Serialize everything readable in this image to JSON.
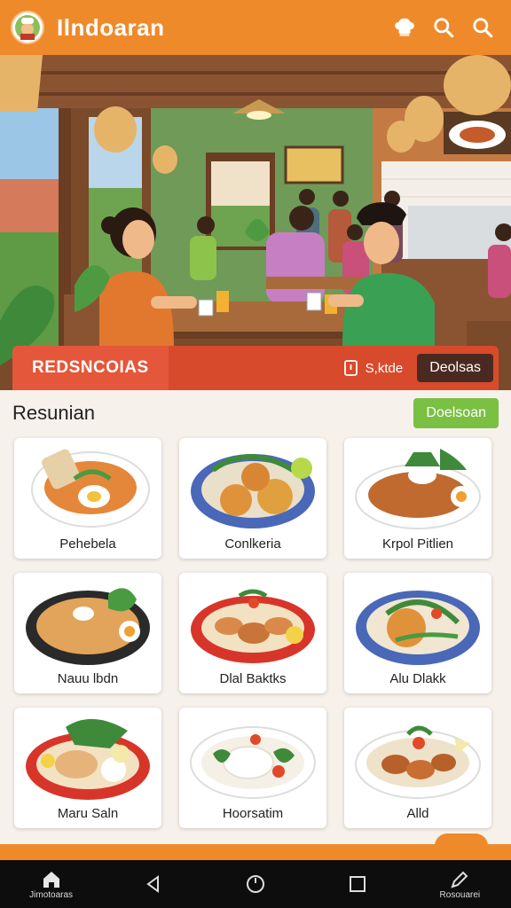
{
  "app": {
    "title": "Ilndoaran"
  },
  "header_icons": [
    "chef-hat-icon",
    "search-icon",
    "search-icon"
  ],
  "hero": {
    "bar_title": "REDSNCOIAS",
    "action_label": "S,ktde",
    "button_label": "Deolsas"
  },
  "section": {
    "title": "Resunian",
    "button_label": "Doelsoan"
  },
  "dishes": [
    {
      "label": "Pehebela"
    },
    {
      "label": "Conlkeria"
    },
    {
      "label": "Krpol Pitlien"
    },
    {
      "label": "Nauu lbdn"
    },
    {
      "label": "Dlal Baktks"
    },
    {
      "label": "Alu Dlakk"
    },
    {
      "label": "Maru Saln"
    },
    {
      "label": "Hoorsatim"
    },
    {
      "label": "Alld"
    }
  ],
  "nav": [
    {
      "label": "Jimotoaras",
      "icon": "home-icon"
    },
    {
      "label": "",
      "icon": "back-icon"
    },
    {
      "label": "",
      "icon": "circle-home-icon"
    },
    {
      "label": "",
      "icon": "square-recents-icon"
    },
    {
      "label": "Rosouarei",
      "icon": "pen-icon"
    }
  ],
  "colors": {
    "primary": "#ef8a2b",
    "hero_bar": "#d84a2c",
    "accent_green": "#7ac043"
  }
}
